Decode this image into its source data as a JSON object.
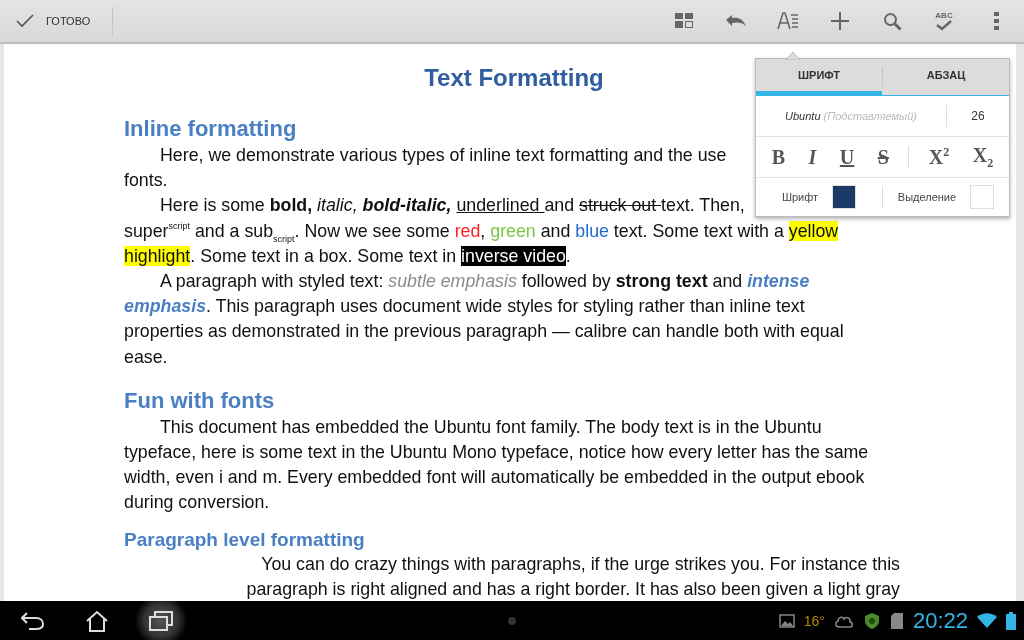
{
  "action_bar": {
    "done_label": "ГОТОВО",
    "actions": [
      {
        "kind": "layout"
      },
      {
        "kind": "undo"
      },
      {
        "kind": "format"
      },
      {
        "kind": "add"
      },
      {
        "kind": "search"
      },
      {
        "kind": "spellcheck",
        "label": "ABC"
      },
      {
        "kind": "overflow"
      }
    ]
  },
  "document": {
    "title": "Text Formatting",
    "blocks": [
      {
        "kind": "heading",
        "text": "Inline formatting"
      },
      {
        "kind": "paragraph",
        "lines": [
          [
            {
              "kind": "plain",
              "text": "Here, we demonstrate various types of inline text formatting and the use"
            }
          ],
          [
            {
              "kind": "plain",
              "text": "fonts."
            }
          ]
        ]
      },
      {
        "kind": "paragraph",
        "lines": [
          [
            {
              "kind": "plain",
              "text": "Here is some "
            },
            {
              "kind": "bold",
              "text": "bold, "
            },
            {
              "kind": "italic",
              "text": "italic, "
            },
            {
              "kind": "bolditalic",
              "text": "bold-italic, "
            },
            {
              "kind": "underline",
              "text": "underlined "
            },
            {
              "kind": "plain",
              "text": "and "
            },
            {
              "kind": "strike",
              "text": "struck out "
            },
            {
              "kind": "plain",
              "text": " text. Then,"
            }
          ],
          [
            {
              "kind": "plain",
              "text": "super"
            },
            {
              "kind": "sup",
              "text": "script"
            },
            {
              "kind": "plain",
              "text": " and a sub"
            },
            {
              "kind": "sub",
              "text": "script"
            },
            {
              "kind": "plain",
              "text": ". Now we see some "
            },
            {
              "kind": "red",
              "text": "red"
            },
            {
              "kind": "plain",
              "text": ", "
            },
            {
              "kind": "green",
              "text": "green"
            },
            {
              "kind": "plain",
              "text": " and "
            },
            {
              "kind": "blue",
              "text": "blue"
            },
            {
              "kind": "plain",
              "text": " text. Some text with a "
            },
            {
              "kind": "highlight",
              "text": "yellow"
            }
          ],
          [
            {
              "kind": "highlight",
              "text": "highlight"
            },
            {
              "kind": "plain",
              "text": ". Some text in a box. Some text in "
            },
            {
              "kind": "inverse",
              "text": "inverse video"
            },
            {
              "kind": "plain",
              "text": "."
            }
          ]
        ]
      },
      {
        "kind": "paragraph",
        "lines": [
          [
            {
              "kind": "plain",
              "text": "A paragraph with styled text: "
            },
            {
              "kind": "subtle",
              "text": "subtle emphasis"
            },
            {
              "kind": "plain",
              "text": "  followed by "
            },
            {
              "kind": "strong",
              "text": "strong text"
            },
            {
              "kind": "plain",
              "text": " and "
            },
            {
              "kind": "intense",
              "text": "intense"
            }
          ],
          [
            {
              "kind": "intense",
              "text": "emphasis"
            },
            {
              "kind": "plain",
              "text": ". This paragraph uses document wide styles for styling rather than inline text"
            }
          ],
          [
            {
              "kind": "plain",
              "text": "properties as demonstrated in the previous paragraph — calibre can handle both with equal"
            }
          ],
          [
            {
              "kind": "plain",
              "text": "ease."
            }
          ]
        ]
      },
      {
        "kind": "heading",
        "text": "Fun with fonts"
      },
      {
        "kind": "paragraph",
        "lines": [
          [
            {
              "kind": "plain",
              "text": "This document has embedded the Ubuntu font family. The body text is in the Ubuntu"
            }
          ],
          [
            {
              "kind": "plain",
              "text": "typeface, here is some text in the Ubuntu Mono typeface, notice how every letter has the same"
            }
          ],
          [
            {
              "kind": "plain",
              "text": "width, even i and m. Every embedded font will automatically be embedded in the output ebook"
            }
          ],
          [
            {
              "kind": "plain",
              "text": "during conversion."
            }
          ]
        ]
      },
      {
        "kind": "subheading",
        "text": "Paragraph level formatting"
      },
      {
        "kind": "rightparagraph",
        "lines": [
          [
            {
              "kind": "plain",
              "text": "You can do crazy things with paragraphs, if the urge strikes you. For instance this"
            }
          ],
          [
            {
              "kind": "plain",
              "text": "paragraph is right aligned and has a right border. It has also been given a light gray"
            }
          ]
        ]
      }
    ]
  },
  "format_popup": {
    "tabs": [
      {
        "label": "ШРИФТ",
        "selected": true
      },
      {
        "label": "АБЗАЦ",
        "selected": false
      }
    ],
    "font_name": "Ubuntu",
    "font_note": "(Подставляемый)",
    "font_size": "26",
    "style_buttons": [
      {
        "kind": "bold",
        "label": "B"
      },
      {
        "kind": "italic",
        "label": "I"
      },
      {
        "kind": "underline",
        "label": "U"
      },
      {
        "kind": "strike",
        "label": "S"
      },
      {
        "kind": "superscript",
        "label": "X$^{2}$"
      },
      {
        "kind": "subscript",
        "label": "X$_{2}$"
      }
    ],
    "colors": [
      {
        "label": "Шрифт",
        "color": "#1c3a66"
      },
      {
        "label": "Выделение",
        "color": "#ffffff"
      }
    ]
  },
  "nav_bar": {
    "buttons": [
      {
        "kind": "back",
        "selected": false
      },
      {
        "kind": "home",
        "selected": false
      },
      {
        "kind": "recent",
        "selected": true
      }
    ],
    "temperature": "16°",
    "time": "20:22"
  }
}
